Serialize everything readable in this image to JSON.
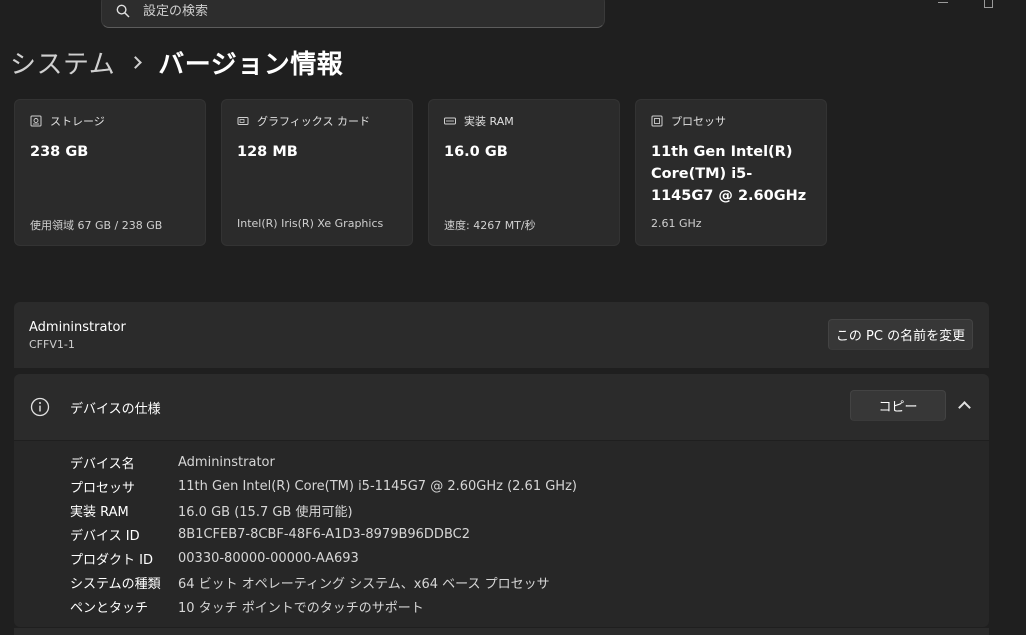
{
  "search": {
    "placeholder": "設定の検索"
  },
  "breadcrumb": {
    "root": "システム",
    "current": "バージョン情報"
  },
  "cards": [
    {
      "icon": "storage-icon",
      "label": "ストレージ",
      "value": "238 GB",
      "sub": "使用領域 67 GB / 238 GB"
    },
    {
      "icon": "graphics-card-icon",
      "label": "グラフィックス カード",
      "value": "128 MB",
      "sub": "Intel(R) Iris(R) Xe Graphics"
    },
    {
      "icon": "ram-icon",
      "label": "実装 RAM",
      "value": "16.0 GB",
      "sub": "速度: 4267 MT/秒"
    },
    {
      "icon": "processor-icon",
      "label": "プロセッサ",
      "value": "11th Gen Intel(R) Core(TM) i5-1145G7 @ 2.60GHz",
      "sub": "2.61 GHz"
    }
  ],
  "pc": {
    "name": "Admininstrator",
    "model": "CFFV1-1",
    "rename_label": "この PC の名前を変更"
  },
  "spec": {
    "title": "デバイスの仕様",
    "copy_label": "コピー",
    "rows": [
      {
        "label": "デバイス名",
        "value": "Admininstrator"
      },
      {
        "label": "プロセッサ",
        "value": "11th Gen Intel(R) Core(TM) i5-1145G7 @ 2.60GHz (2.61 GHz)"
      },
      {
        "label": "実装 RAM",
        "value": "16.0 GB (15.7 GB 使用可能)"
      },
      {
        "label": "デバイス ID",
        "value": "8B1CFEB7-8CBF-48F6-A1D3-8979B96DDBC2"
      },
      {
        "label": "プロダクト ID",
        "value": "00330-80000-00000-AA693"
      },
      {
        "label": "システムの種類",
        "value": "64 ビット オペレーティング システム、x64 ベース プロセッサ"
      },
      {
        "label": "ペンとタッチ",
        "value": "10 タッチ ポイントでのタッチのサポート"
      }
    ]
  }
}
